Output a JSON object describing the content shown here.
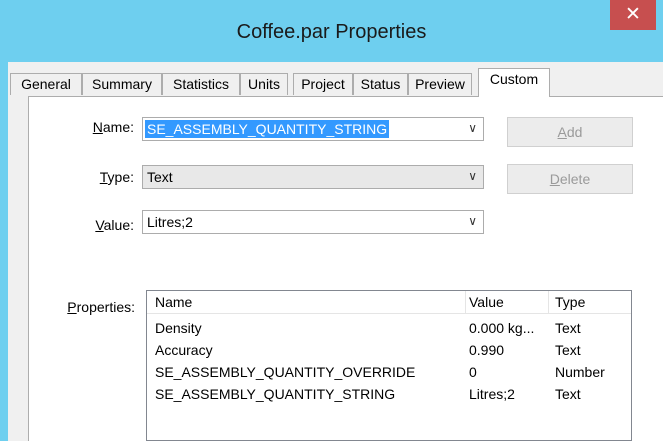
{
  "window": {
    "title": "Coffee.par Properties",
    "close_glyph": "✕"
  },
  "tabs": [
    {
      "label": "General"
    },
    {
      "label": "Summary"
    },
    {
      "label": "Statistics"
    },
    {
      "label": "Units"
    },
    {
      "label": "Project"
    },
    {
      "label": "Status"
    },
    {
      "label": "Preview"
    },
    {
      "label": "Custom"
    }
  ],
  "active_tab": "Custom",
  "form": {
    "name_label": {
      "accel": "N",
      "rest": "ame:"
    },
    "name_value": "SE_ASSEMBLY_QUANTITY_STRING",
    "type_label": {
      "accel": "T",
      "rest": "ype:"
    },
    "type_value": "Text",
    "value_label": {
      "accel": "V",
      "rest": "alue:"
    },
    "value_value": "Litres;2",
    "properties_label": {
      "accel": "P",
      "rest": "roperties:"
    }
  },
  "buttons": {
    "add": {
      "accel": "A",
      "rest": "dd"
    },
    "delete": {
      "accel": "D",
      "rest": "elete"
    }
  },
  "list": {
    "columns": [
      "Name",
      "Value",
      "Type"
    ],
    "rows": [
      [
        "Density",
        "0.000 kg...",
        "Text"
      ],
      [
        "Accuracy",
        "0.990",
        "Text"
      ],
      [
        "SE_ASSEMBLY_QUANTITY_OVERRIDE",
        "0",
        "Number"
      ],
      [
        "SE_ASSEMBLY_QUANTITY_STRING",
        "Litres;2",
        "Text"
      ]
    ]
  },
  "icons": {
    "dropdown": "chevron-down-icon",
    "close": "close-icon"
  }
}
